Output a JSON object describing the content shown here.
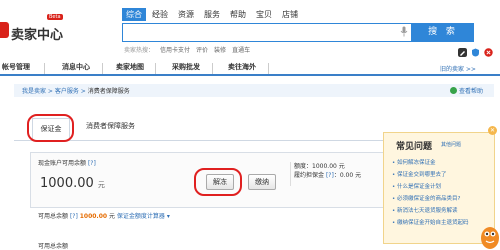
{
  "header": {
    "logo_text": "卖家中心",
    "logo_badge": "Beta",
    "search_tabs": [
      "综合",
      "经验",
      "资源",
      "服务",
      "帮助",
      "宝贝",
      "店铺"
    ],
    "search_button": "搜 索",
    "hot_label": "卖家热搜：",
    "hot_terms": [
      "信用卡支付",
      "评价",
      "装修",
      "直通车"
    ]
  },
  "nav": {
    "items": [
      "帐号管理",
      "消息中心",
      "卖家地图",
      "采购批发",
      "卖往海外"
    ],
    "old_version": "旧的卖家 >>"
  },
  "breadcrumb": {
    "root": "我是卖家",
    "mid": "客户服务",
    "current": "消费者保障服务",
    "sep": " > ",
    "help": "查看帮助"
  },
  "tabs": {
    "deposit": "保证金",
    "protection": "消费者保障服务"
  },
  "deposit": {
    "balance_label": "现金账户可用余额",
    "help_mark": "[?]",
    "balance_value": "1000.00",
    "balance_unit": "元",
    "unfreeze_button": "解冻",
    "pay_button": "缴纳",
    "quota_label": "额度：",
    "quota_value": "1000.00 元",
    "perf_label": "履约担保金",
    "perf_value": "：0.00 元",
    "available_label": "可用总余额",
    "available_value": "1000.00",
    "available_unit": "元",
    "calc_link": "保证金额度计算器",
    "sync_text": "可用总余额"
  },
  "faq": {
    "title": "常见问题",
    "more": "其他问题",
    "items": [
      "如何解冻保证金",
      "保证金交到哪里去了",
      "什么是保证金计划",
      "必须缴保证金的商品类目?",
      "新消法七天退货服务解读",
      "缴纳保证金开始自主退货起码"
    ]
  },
  "colors": {
    "brand_red": "#d9221a",
    "primary_blue": "#2f86d8",
    "link_blue": "#2f6fb5",
    "highlight_red": "#e02020",
    "money_orange": "#e56b00"
  }
}
